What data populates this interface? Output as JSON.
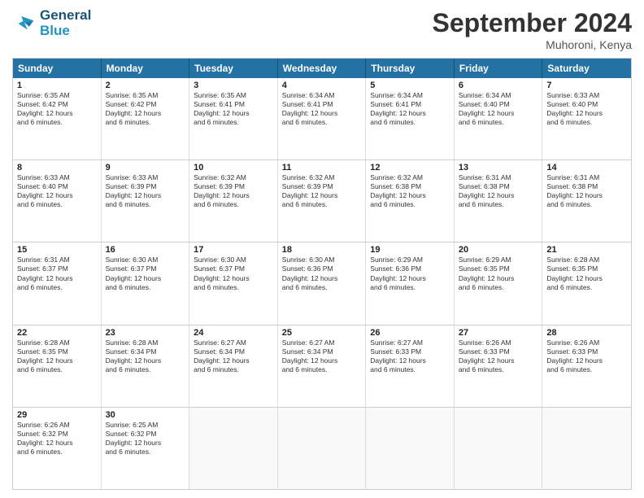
{
  "logo": {
    "line1": "General",
    "line2": "Blue"
  },
  "title": "September 2024",
  "location": "Muhoroni, Kenya",
  "header_days": [
    "Sunday",
    "Monday",
    "Tuesday",
    "Wednesday",
    "Thursday",
    "Friday",
    "Saturday"
  ],
  "weeks": [
    [
      {
        "day": "1",
        "lines": [
          "Sunrise: 6:35 AM",
          "Sunset: 6:42 PM",
          "Daylight: 12 hours",
          "and 6 minutes."
        ]
      },
      {
        "day": "2",
        "lines": [
          "Sunrise: 6:35 AM",
          "Sunset: 6:42 PM",
          "Daylight: 12 hours",
          "and 6 minutes."
        ]
      },
      {
        "day": "3",
        "lines": [
          "Sunrise: 6:35 AM",
          "Sunset: 6:41 PM",
          "Daylight: 12 hours",
          "and 6 minutes."
        ]
      },
      {
        "day": "4",
        "lines": [
          "Sunrise: 6:34 AM",
          "Sunset: 6:41 PM",
          "Daylight: 12 hours",
          "and 6 minutes."
        ]
      },
      {
        "day": "5",
        "lines": [
          "Sunrise: 6:34 AM",
          "Sunset: 6:41 PM",
          "Daylight: 12 hours",
          "and 6 minutes."
        ]
      },
      {
        "day": "6",
        "lines": [
          "Sunrise: 6:34 AM",
          "Sunset: 6:40 PM",
          "Daylight: 12 hours",
          "and 6 minutes."
        ]
      },
      {
        "day": "7",
        "lines": [
          "Sunrise: 6:33 AM",
          "Sunset: 6:40 PM",
          "Daylight: 12 hours",
          "and 6 minutes."
        ]
      }
    ],
    [
      {
        "day": "8",
        "lines": [
          "Sunrise: 6:33 AM",
          "Sunset: 6:40 PM",
          "Daylight: 12 hours",
          "and 6 minutes."
        ]
      },
      {
        "day": "9",
        "lines": [
          "Sunrise: 6:33 AM",
          "Sunset: 6:39 PM",
          "Daylight: 12 hours",
          "and 6 minutes."
        ]
      },
      {
        "day": "10",
        "lines": [
          "Sunrise: 6:32 AM",
          "Sunset: 6:39 PM",
          "Daylight: 12 hours",
          "and 6 minutes."
        ]
      },
      {
        "day": "11",
        "lines": [
          "Sunrise: 6:32 AM",
          "Sunset: 6:39 PM",
          "Daylight: 12 hours",
          "and 6 minutes."
        ]
      },
      {
        "day": "12",
        "lines": [
          "Sunrise: 6:32 AM",
          "Sunset: 6:38 PM",
          "Daylight: 12 hours",
          "and 6 minutes."
        ]
      },
      {
        "day": "13",
        "lines": [
          "Sunrise: 6:31 AM",
          "Sunset: 6:38 PM",
          "Daylight: 12 hours",
          "and 6 minutes."
        ]
      },
      {
        "day": "14",
        "lines": [
          "Sunrise: 6:31 AM",
          "Sunset: 6:38 PM",
          "Daylight: 12 hours",
          "and 6 minutes."
        ]
      }
    ],
    [
      {
        "day": "15",
        "lines": [
          "Sunrise: 6:31 AM",
          "Sunset: 6:37 PM",
          "Daylight: 12 hours",
          "and 6 minutes."
        ]
      },
      {
        "day": "16",
        "lines": [
          "Sunrise: 6:30 AM",
          "Sunset: 6:37 PM",
          "Daylight: 12 hours",
          "and 6 minutes."
        ]
      },
      {
        "day": "17",
        "lines": [
          "Sunrise: 6:30 AM",
          "Sunset: 6:37 PM",
          "Daylight: 12 hours",
          "and 6 minutes."
        ]
      },
      {
        "day": "18",
        "lines": [
          "Sunrise: 6:30 AM",
          "Sunset: 6:36 PM",
          "Daylight: 12 hours",
          "and 6 minutes."
        ]
      },
      {
        "day": "19",
        "lines": [
          "Sunrise: 6:29 AM",
          "Sunset: 6:36 PM",
          "Daylight: 12 hours",
          "and 6 minutes."
        ]
      },
      {
        "day": "20",
        "lines": [
          "Sunrise: 6:29 AM",
          "Sunset: 6:35 PM",
          "Daylight: 12 hours",
          "and 6 minutes."
        ]
      },
      {
        "day": "21",
        "lines": [
          "Sunrise: 6:28 AM",
          "Sunset: 6:35 PM",
          "Daylight: 12 hours",
          "and 6 minutes."
        ]
      }
    ],
    [
      {
        "day": "22",
        "lines": [
          "Sunrise: 6:28 AM",
          "Sunset: 6:35 PM",
          "Daylight: 12 hours",
          "and 6 minutes."
        ]
      },
      {
        "day": "23",
        "lines": [
          "Sunrise: 6:28 AM",
          "Sunset: 6:34 PM",
          "Daylight: 12 hours",
          "and 6 minutes."
        ]
      },
      {
        "day": "24",
        "lines": [
          "Sunrise: 6:27 AM",
          "Sunset: 6:34 PM",
          "Daylight: 12 hours",
          "and 6 minutes."
        ]
      },
      {
        "day": "25",
        "lines": [
          "Sunrise: 6:27 AM",
          "Sunset: 6:34 PM",
          "Daylight: 12 hours",
          "and 6 minutes."
        ]
      },
      {
        "day": "26",
        "lines": [
          "Sunrise: 6:27 AM",
          "Sunset: 6:33 PM",
          "Daylight: 12 hours",
          "and 6 minutes."
        ]
      },
      {
        "day": "27",
        "lines": [
          "Sunrise: 6:26 AM",
          "Sunset: 6:33 PM",
          "Daylight: 12 hours",
          "and 6 minutes."
        ]
      },
      {
        "day": "28",
        "lines": [
          "Sunrise: 6:26 AM",
          "Sunset: 6:33 PM",
          "Daylight: 12 hours",
          "and 6 minutes."
        ]
      }
    ],
    [
      {
        "day": "29",
        "lines": [
          "Sunrise: 6:26 AM",
          "Sunset: 6:32 PM",
          "Daylight: 12 hours",
          "and 6 minutes."
        ]
      },
      {
        "day": "30",
        "lines": [
          "Sunrise: 6:25 AM",
          "Sunset: 6:32 PM",
          "Daylight: 12 hours",
          "and 6 minutes."
        ]
      },
      {
        "day": "",
        "lines": []
      },
      {
        "day": "",
        "lines": []
      },
      {
        "day": "",
        "lines": []
      },
      {
        "day": "",
        "lines": []
      },
      {
        "day": "",
        "lines": []
      }
    ]
  ]
}
